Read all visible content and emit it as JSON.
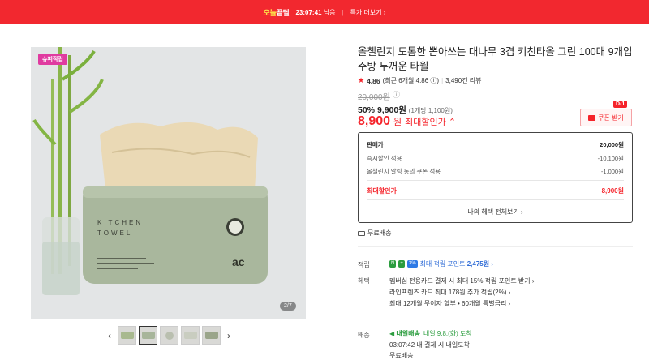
{
  "topbar": {
    "brand_a": "오늘",
    "brand_b": "끝딜",
    "timer": "23:07:41",
    "timer_suffix": " 남음",
    "link": "특가 더보기 ›"
  },
  "gallery": {
    "badge": "슈퍼적립",
    "counter": "2/7",
    "thumb_count": 5
  },
  "product": {
    "title": "올챌린지 도톰한 뽑아쓰는 대나무 3겹 키친타올 그린 100매 9개입 주방 두꺼운 타월",
    "rating": "4.86",
    "rating_detail": "(최근 6개월 4.86 ⓘ)",
    "review_count": "3,490건 리뷰",
    "original_price": "20,000원",
    "discount": "50%",
    "sale_price": "9,900원",
    "unit_price": "(1개당 1,100원)",
    "max_price": "8,900",
    "max_price_won": "원",
    "max_price_label": "최대할인가 ⌃",
    "coupon_label": "쿠폰 받기",
    "coupon_tag": "D-1"
  },
  "pricebox": {
    "rows": [
      {
        "label": "판매가",
        "value": "20,000원"
      },
      {
        "label": "즉시할인 적용",
        "value": "-10,100원"
      },
      {
        "label": "올챌린지 알림 동의 쿠폰 적용",
        "value": "-1,000원"
      },
      {
        "label": "최대할인가",
        "value": "8,900원"
      }
    ],
    "benefit_link": "나의 혜택 전체보기 ›"
  },
  "shipping_free": "무료배송",
  "point": {
    "label": "적립",
    "icon_a": "N",
    "icon_b": "+",
    "icon_c": "3%",
    "text": "최대 적립 포인트",
    "amount": "2,475원",
    "chevron": "›"
  },
  "benefit": {
    "label": "혜택",
    "lines": [
      "멤버십 전용카드 결제 시 최대 15% 적립 포인트 받기 ›",
      "라인프렌즈 카드 최대 178원 추가 적립(2%) ›",
      "최대 12개월 무이자 할부 • 60개월 특별금리 ›"
    ]
  },
  "delivery": {
    "label": "배송",
    "badge": "내일배송",
    "date": "내일 9.8.(화) 도착",
    "sub": "03:07:42  내 결제 시 내일도착",
    "free": "무료배송"
  }
}
